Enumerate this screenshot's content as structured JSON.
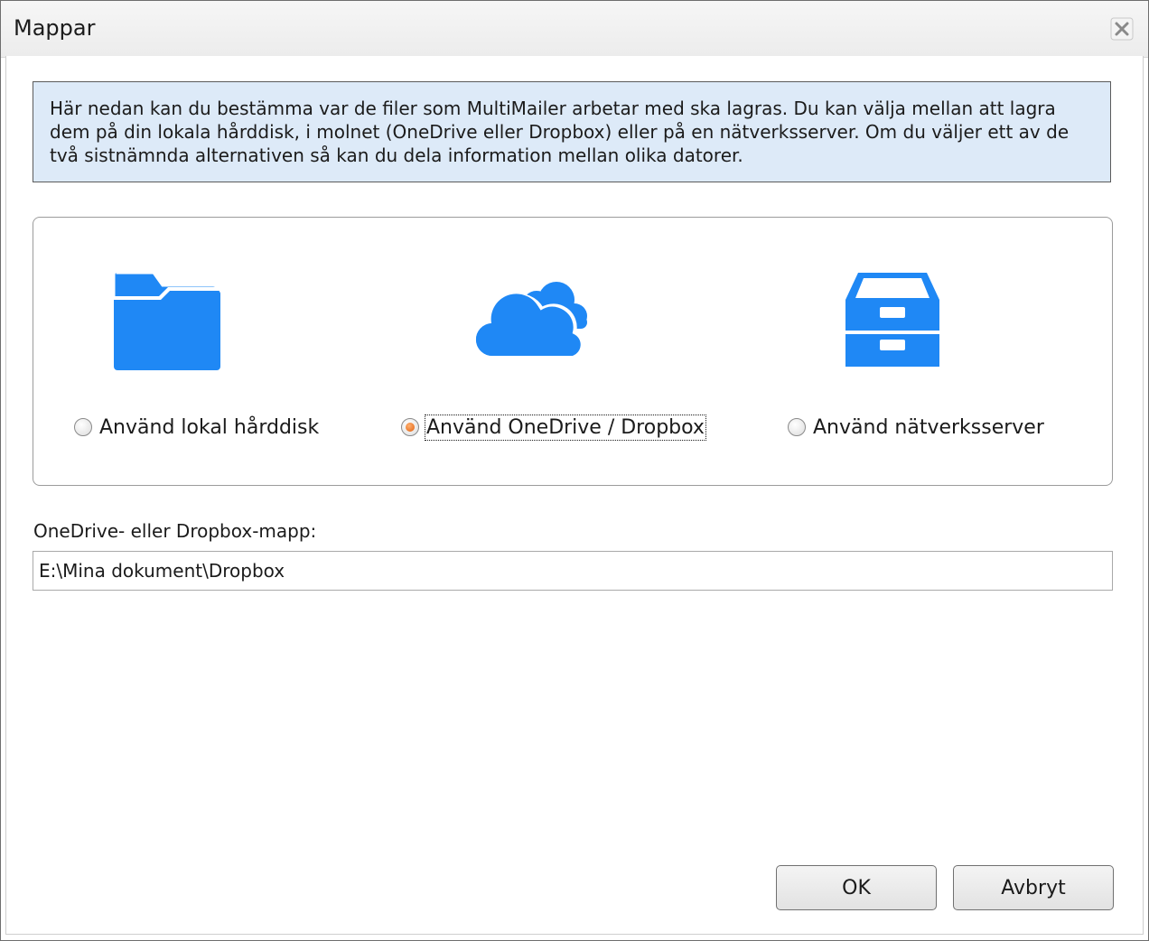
{
  "window": {
    "title": "Mappar",
    "close_icon": "close-icon"
  },
  "info": {
    "text": "Här nedan kan du bestämma var de filer som MultiMailer arbetar med ska lagras. Du kan välja mellan att lagra dem på din lokala hårddisk, i molnet (OneDrive eller Dropbox) eller på en nätverksserver. Om du väljer ett av de två sistnämnda alternativen så kan du dela information mellan olika datorer."
  },
  "options": [
    {
      "label": "Använd lokal hårddisk",
      "icon": "folder-icon",
      "selected": false
    },
    {
      "label": "Använd OneDrive / Dropbox",
      "icon": "cloud-icon",
      "selected": true
    },
    {
      "label": "Använd nätverksserver",
      "icon": "server-tray-icon",
      "selected": false
    }
  ],
  "folder_field": {
    "label": "OneDrive- eller Dropbox-mapp:",
    "value": "E:\\Mina dokument\\Dropbox"
  },
  "buttons": {
    "ok": "OK",
    "cancel": "Avbryt"
  },
  "colors": {
    "accent_blue": "#1f88f5",
    "info_background": "#ddeaf8",
    "radio_selected": "#e0600f"
  }
}
